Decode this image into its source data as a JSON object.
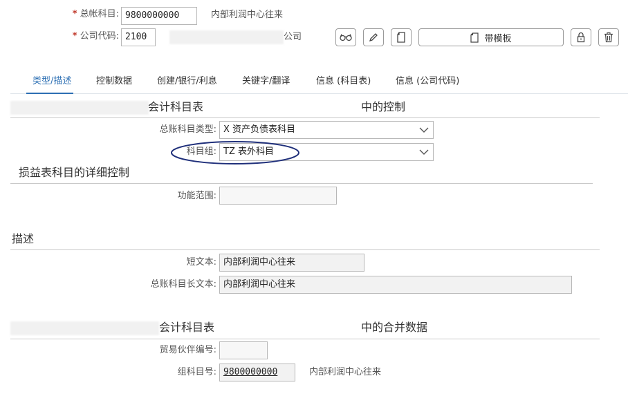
{
  "header": {
    "gl_account": {
      "label": "总帐科目:",
      "value": "9800000000",
      "desc": "内部利润中心往来"
    },
    "company_code": {
      "label": "公司代码:",
      "value": "2100",
      "desc": "公司"
    },
    "template_button": "带模板",
    "icons": [
      "glasses-icon",
      "pencil-icon",
      "copy-icon",
      "template-doc-icon",
      "lock-icon",
      "trash-icon"
    ]
  },
  "tabs": [
    {
      "label": "类型/描述",
      "active": true
    },
    {
      "label": "控制数据"
    },
    {
      "label": "创建/银行/利息"
    },
    {
      "label": "关键字/翻译"
    },
    {
      "label": "信息 (科目表)"
    },
    {
      "label": "信息 (公司代码)"
    }
  ],
  "section_coa_control": {
    "title_part1": "会计科目表",
    "title_part2": "中的控制",
    "account_type": {
      "label": "总账科目类型:",
      "value": "X 资产负债表科目"
    },
    "account_group": {
      "label": "科目组:",
      "value": "TZ 表外科目"
    }
  },
  "section_pl": {
    "title": "损益表科目的详细控制",
    "functional_area": {
      "label": "功能范围:",
      "value": ""
    }
  },
  "section_desc": {
    "title": "描述",
    "short_text": {
      "label": "短文本:",
      "value": "内部利润中心往来"
    },
    "long_text": {
      "label": "总账科目长文本:",
      "value": "内部利润中心往来"
    }
  },
  "section_consolidation": {
    "title_part1": "会计科目表",
    "title_part2": "中的合并数据",
    "trading_partner": {
      "label": "贸易伙伴编号:",
      "value": ""
    },
    "group_account": {
      "label": "组科目号:",
      "value": "9800000000",
      "desc": "内部利润中心往来"
    }
  },
  "colors": {
    "accent": "#2c6fb3",
    "required": "#c0392b",
    "highlight_oval": "#1f2f7a"
  }
}
